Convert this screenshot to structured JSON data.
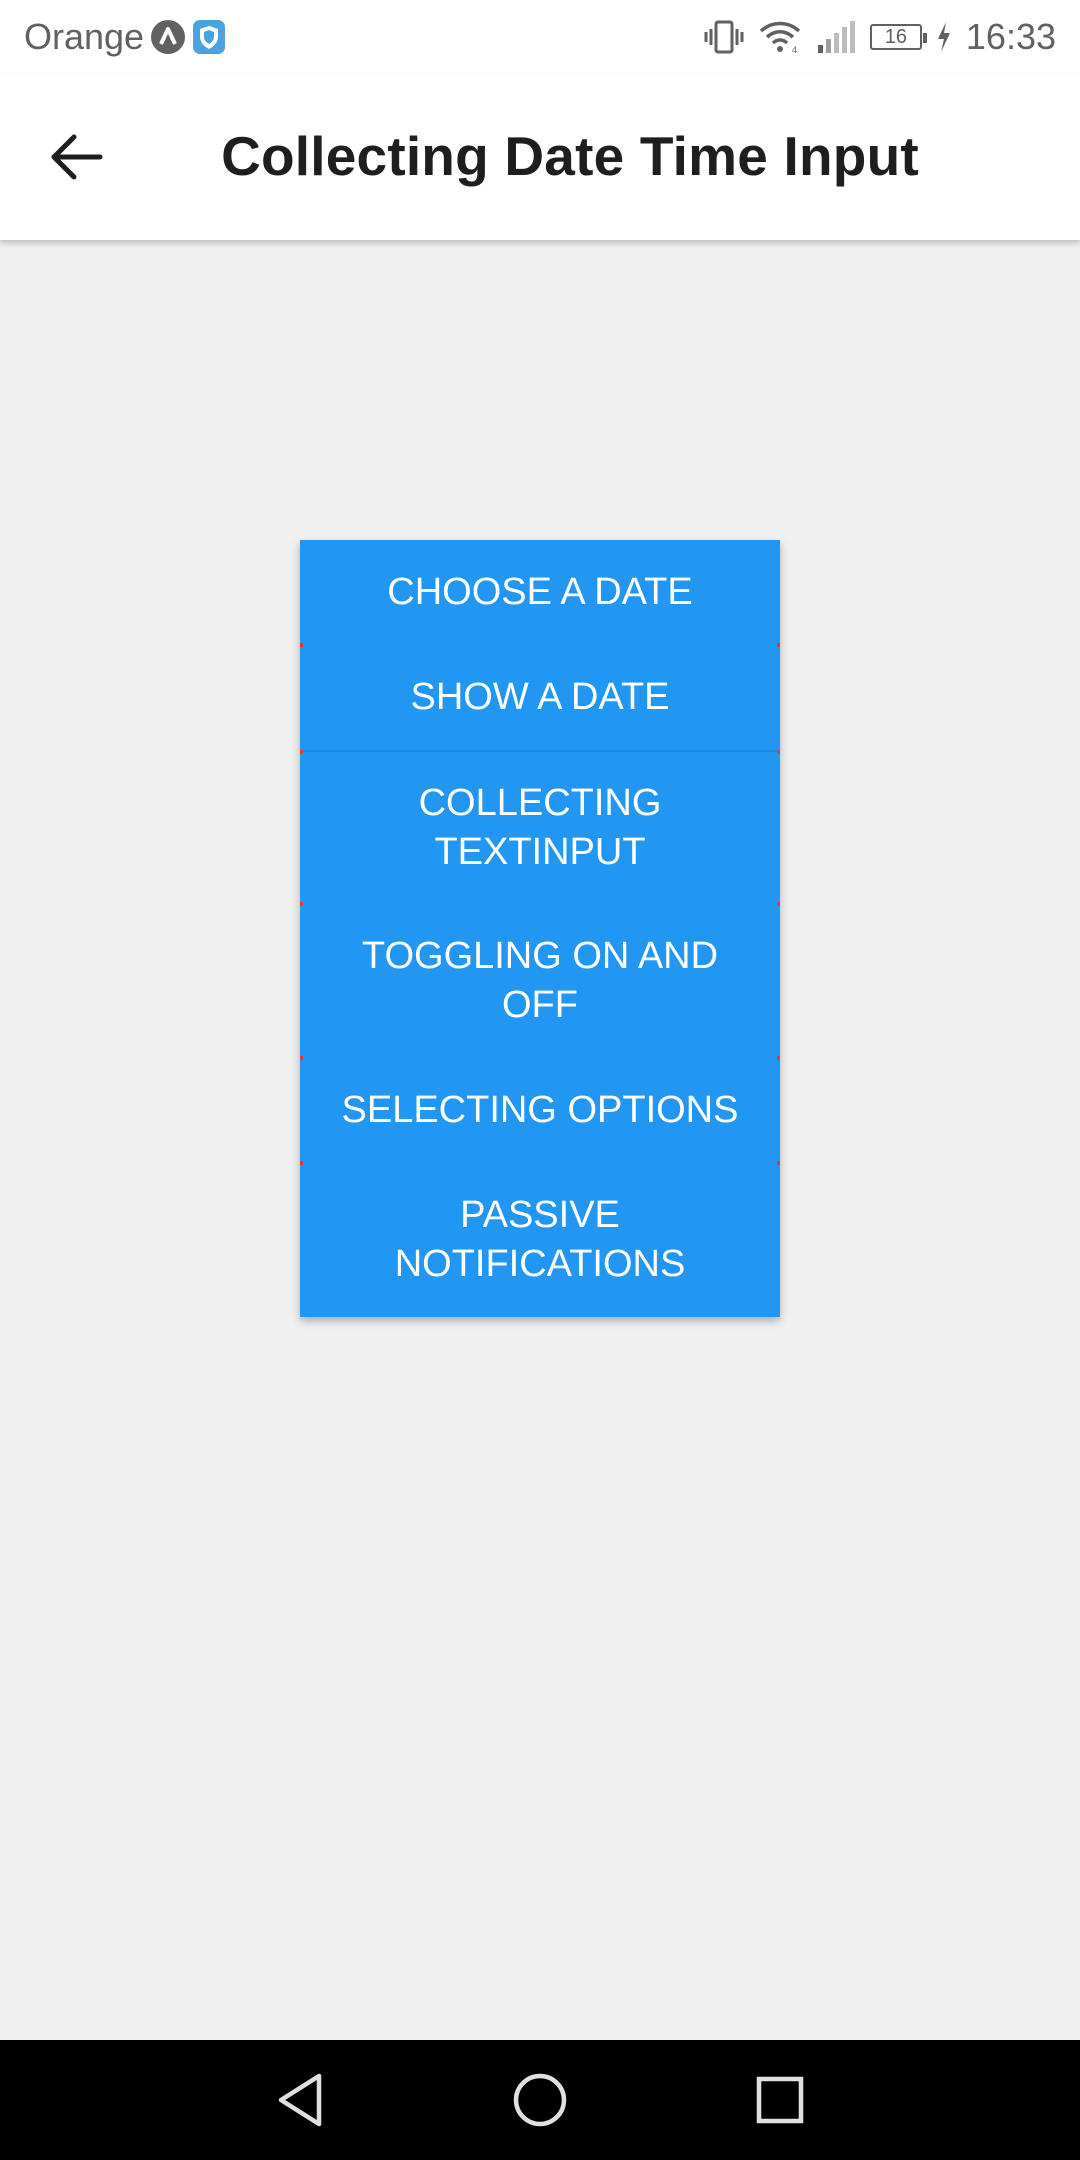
{
  "status_bar": {
    "carrier": "Orange",
    "battery_level": "16",
    "time": "16:33"
  },
  "app_bar": {
    "title": "Collecting Date Time Input"
  },
  "menu": {
    "items": [
      {
        "label": "CHOOSE A DATE"
      },
      {
        "label": "SHOW A DATE"
      },
      {
        "label": "COLLECTING TEXTINPUT"
      },
      {
        "label": "TOGGLING ON AND OFF"
      },
      {
        "label": "SELECTING OPTIONS"
      },
      {
        "label": "PASSIVE NOTIFICATIONS"
      }
    ]
  },
  "colors": {
    "button_background": "#2196f3",
    "page_background": "#f0f0f0",
    "app_bar": "#ffffff",
    "nav_bar": "#000000"
  },
  "icons": {
    "back": "arrow-left-icon",
    "nav_back": "triangle-back-icon",
    "nav_home": "circle-home-icon",
    "nav_recents": "square-recents-icon"
  }
}
